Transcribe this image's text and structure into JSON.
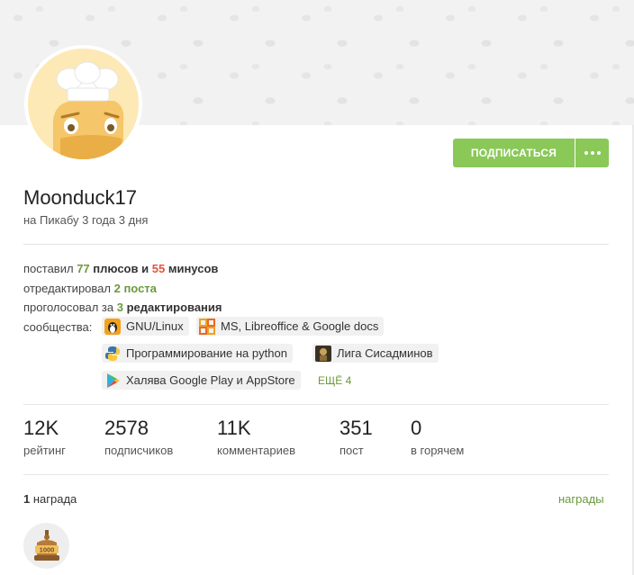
{
  "profile": {
    "username": "Moonduck17",
    "age": "на Пикабу 3 года 3 дня",
    "subscribe_label": "ПОДПИСАТЬСЯ"
  },
  "activity": {
    "line1": {
      "prefix": "поставил",
      "plus_count": "77",
      "plus_word": "плюсов",
      "conj": "и",
      "minus_count": "55",
      "minus_word": "минусов"
    },
    "line2": {
      "prefix": "отредактировал",
      "value": "2 поста"
    },
    "line3": {
      "prefix": "проголосовал за",
      "count": "3",
      "rest": "редактирования"
    },
    "communities_label": "сообщества:",
    "communities": [
      {
        "name": "GNU/Linux",
        "icon": "tux-icon"
      },
      {
        "name": "MS, Libreoffice & Google docs",
        "icon": "office-icon"
      },
      {
        "name": "Программирование на python",
        "icon": "python-icon"
      },
      {
        "name": "Лига Сисадминов",
        "icon": "sysadmin-icon"
      },
      {
        "name": "Халява Google Play и AppStore",
        "icon": "play-store-icon"
      }
    ],
    "more_label": "ЕЩЁ 4"
  },
  "stats": [
    {
      "value": "12K",
      "label": "рейтинг"
    },
    {
      "value": "2578",
      "label": "подписчиков"
    },
    {
      "value": "11K",
      "label": "комментариев"
    },
    {
      "value": "351",
      "label": "пост"
    },
    {
      "value": "0",
      "label": "в горячем"
    }
  ],
  "awards": {
    "count": "1",
    "count_word": "награда",
    "link_label": "награды",
    "medal_text": "1000"
  },
  "colors": {
    "accent_green": "#8ac858",
    "link_green": "#6a9a3c",
    "minus_red": "#e0533f"
  }
}
